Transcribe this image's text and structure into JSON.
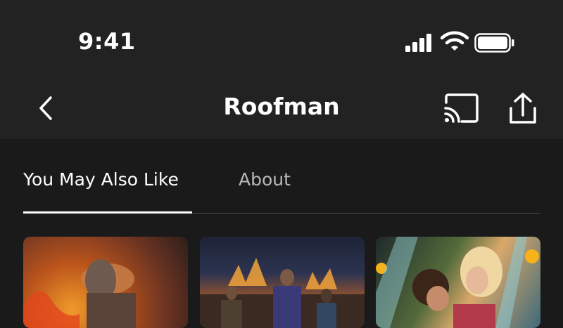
{
  "status_bar": {
    "time": "9:41"
  },
  "nav": {
    "title": "Roofman",
    "back_icon": "chevron-left-icon",
    "cast_icon": "cast-icon",
    "share_icon": "share-icon"
  },
  "tabs": [
    {
      "label": "You May Also Like",
      "active": true
    },
    {
      "label": "About",
      "active": false
    }
  ],
  "recommendations": [
    {
      "thumbnail": "firefighter-helmet-flames"
    },
    {
      "thumbnail": "group-portrait-fire"
    },
    {
      "thumbnail": "couple-embrace-sunset"
    }
  ],
  "colors": {
    "background": "#1a1a1a",
    "header": "#222222",
    "active_tab": "#ffffff",
    "inactive_tab": "#b9b9b9"
  }
}
